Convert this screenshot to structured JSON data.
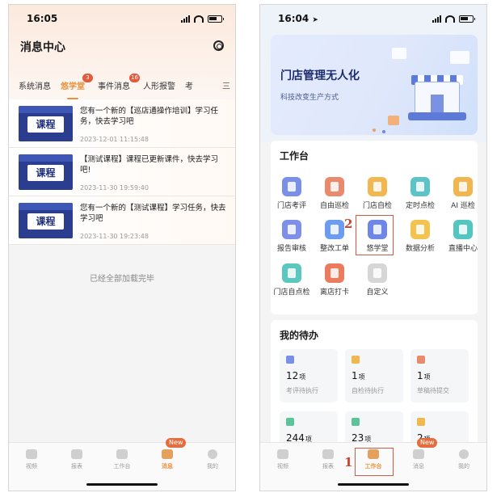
{
  "left": {
    "time": "16:05",
    "title": "消息中心",
    "tabs": [
      {
        "label": "系统消息",
        "badge": ""
      },
      {
        "label": "悠学堂",
        "badge": "3"
      },
      {
        "label": "事件消息",
        "badge": "16"
      },
      {
        "label": "人形报警",
        "badge": ""
      },
      {
        "label": "考",
        "badge": ""
      }
    ],
    "more_label": "三",
    "messages": [
      {
        "thumb": "课程",
        "text": "您有一个新的【巡店通操作培训】学习任务，快去学习吧",
        "time": "2023-12-01 11:15:48"
      },
      {
        "thumb": "课程",
        "text": "【测试课程】课程已更新课件，快去学习吧!",
        "time": "2023-11-30 19:59:40"
      },
      {
        "thumb": "课程",
        "text": "您有一个新的【测试课程】学习任务，快去学习吧",
        "time": "2023-11-30 19:23:48"
      }
    ],
    "end_text": "已经全部加载完毕",
    "tabbar": [
      {
        "label": "视频"
      },
      {
        "label": "报表"
      },
      {
        "label": "工作台"
      },
      {
        "label": "消息",
        "badge": "New"
      },
      {
        "label": "我的"
      }
    ]
  },
  "right": {
    "time": "16:04",
    "banner": {
      "title": "门店管理无人化",
      "subtitle": "科技改变生产方式"
    },
    "workbench_title": "工作台",
    "grid": [
      {
        "label": "门店考评",
        "color": "#7a8fe6"
      },
      {
        "label": "自由巡检",
        "color": "#e98a6d"
      },
      {
        "label": "门店自检",
        "color": "#f1b84f"
      },
      {
        "label": "定时点检",
        "color": "#5cc4c9"
      },
      {
        "label": "AI 巡检",
        "color": "#f2b650"
      },
      {
        "label": "报告审核",
        "color": "#7d8fe8"
      },
      {
        "label": "整改工单",
        "color": "#6b9cf0"
      },
      {
        "label": "悠学堂",
        "color": "#6f86e8"
      },
      {
        "label": "数据分析",
        "color": "#f2c34f"
      },
      {
        "label": "直播中心",
        "color": "#55c5c0"
      },
      {
        "label": "门店自点检",
        "color": "#5cc7be"
      },
      {
        "label": "离店打卡",
        "color": "#ec7a5c"
      },
      {
        "label": "自定义",
        "color": "#d6d6d6"
      }
    ],
    "annot_1": "1",
    "annot_2": "2",
    "todo_title": "我的待办",
    "todos": [
      {
        "num": "12",
        "unit": "项",
        "label": "考评待执行",
        "color": "#7a8fe6"
      },
      {
        "num": "1",
        "unit": "项",
        "label": "自检待执行",
        "color": "#f1b84f"
      },
      {
        "num": "1",
        "unit": "项",
        "label": "草稿待提交",
        "color": "#e98a6d"
      },
      {
        "num": "244",
        "unit": "项",
        "label": "",
        "color": "#5cc49b"
      },
      {
        "num": "23",
        "unit": "项",
        "label": "",
        "color": "#5cc49b"
      },
      {
        "num": "2",
        "unit": "项",
        "label": "",
        "color": "#f1b84f"
      }
    ],
    "tabbar": [
      {
        "label": "视频"
      },
      {
        "label": "报表"
      },
      {
        "label": "工作台"
      },
      {
        "label": "消息",
        "badge": "New"
      },
      {
        "label": "我的"
      }
    ]
  }
}
